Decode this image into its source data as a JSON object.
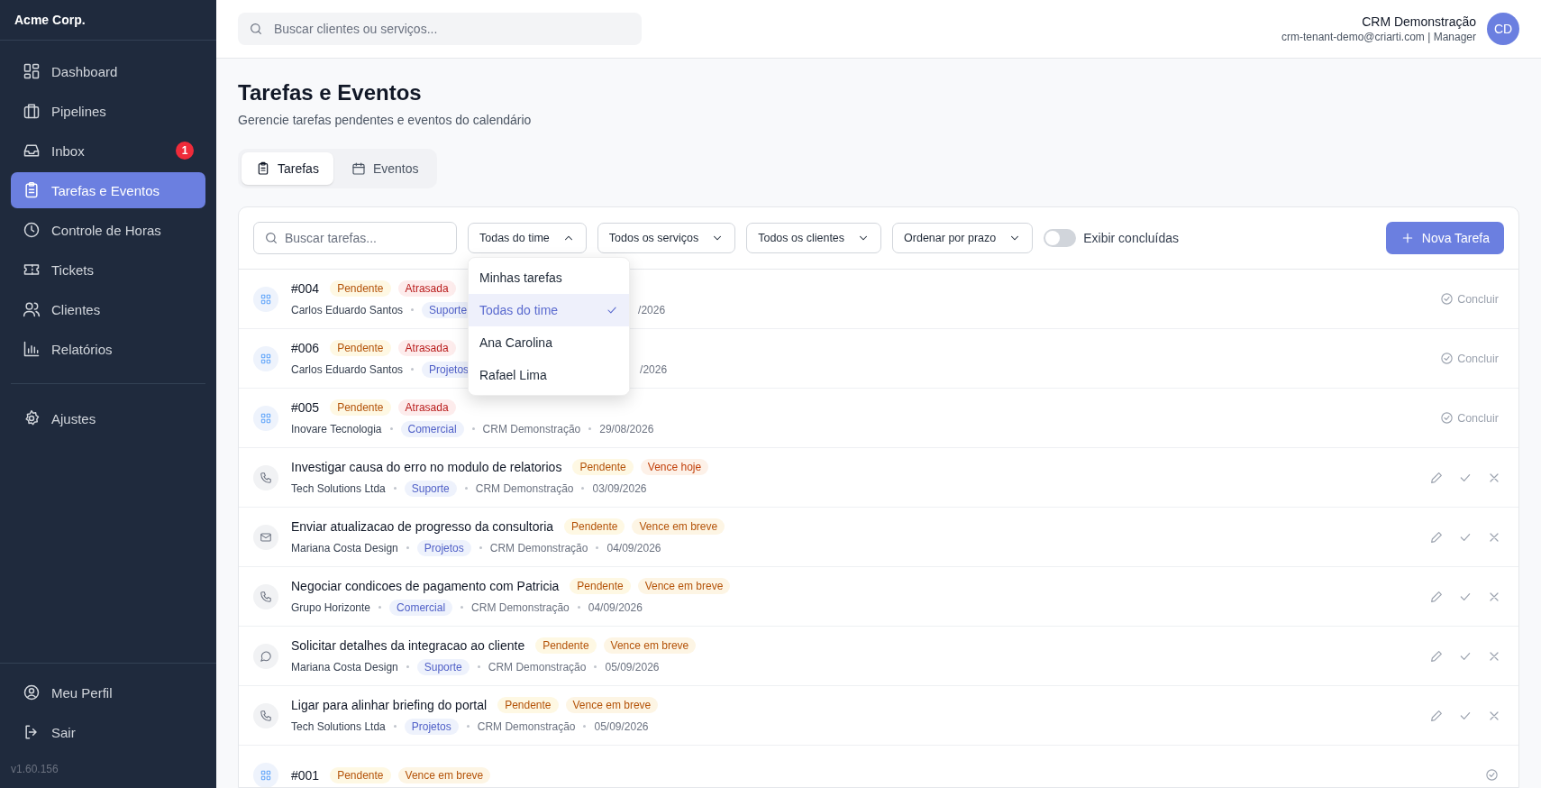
{
  "sidebar": {
    "brand": "Acme Corp.",
    "items": [
      {
        "label": "Dashboard",
        "selected": false
      },
      {
        "label": "Pipelines",
        "selected": false
      },
      {
        "label": "Inbox",
        "selected": false,
        "badge": "1"
      },
      {
        "label": "Tarefas e Eventos",
        "selected": true
      },
      {
        "label": "Controle de Horas",
        "selected": false
      },
      {
        "label": "Tickets",
        "selected": false
      },
      {
        "label": "Clientes",
        "selected": false
      },
      {
        "label": "Relatórios",
        "selected": false
      }
    ],
    "settings": {
      "label": "Ajustes",
      "selected": false
    },
    "footer_items": [
      {
        "label": "Meu Perfil"
      },
      {
        "label": "Sair"
      }
    ],
    "version": "v1.60.156"
  },
  "header": {
    "search": {
      "placeholder": "Buscar clientes ou serviços..."
    },
    "user": {
      "name": "CRM Demonstração",
      "details": "crm-tenant-demo@criarti.com | Manager",
      "initials": "CD"
    }
  },
  "page": {
    "title": "Tarefas e Eventos",
    "subtitle": "Gerencie tarefas pendentes e eventos do calendário"
  },
  "tabs": [
    {
      "label": "Tarefas",
      "selected": true
    },
    {
      "label": "Eventos",
      "selected": false
    }
  ],
  "filters": {
    "search": {
      "placeholder": "Buscar tarefas..."
    },
    "dropdowns": [
      {
        "label": "Todas do time",
        "expanded": true
      },
      {
        "label": "Todos os serviços",
        "expanded": false
      },
      {
        "label": "Todos os clientes",
        "expanded": false
      },
      {
        "label": "Ordenar por prazo",
        "expanded": false
      }
    ],
    "toggle": {
      "label": "Exibir concluídas",
      "on": false
    },
    "new_button": "Nova Tarefa"
  },
  "dropdown_menu": {
    "options": [
      {
        "label": "Minhas tarefas",
        "selected": false
      },
      {
        "label": "Todas do time",
        "selected": true
      },
      {
        "label": "Ana Carolina",
        "selected": false
      },
      {
        "label": "Rafael Lima",
        "selected": false
      }
    ]
  },
  "tasks": [
    {
      "kind": "code",
      "title": "#004",
      "badges": [
        {
          "label": "Pendente",
          "kind": "pending"
        },
        {
          "label": "Atrasada",
          "kind": "overdue"
        }
      ],
      "client": "Carlos Eduardo Santos",
      "service": "Suporte",
      "date": "/2026",
      "action": "Concluir"
    },
    {
      "kind": "code",
      "title": "#006",
      "badges": [
        {
          "label": "Pendente",
          "kind": "pending"
        },
        {
          "label": "Atrasada",
          "kind": "overdue"
        }
      ],
      "client": "Carlos Eduardo Santos",
      "service": "Projetos",
      "date": "/2026",
      "action": "Concluir"
    },
    {
      "kind": "code",
      "title": "#005",
      "badges": [
        {
          "label": "Pendente",
          "kind": "pending"
        },
        {
          "label": "Atrasada",
          "kind": "overdue"
        }
      ],
      "client": "Inovare Tecnologia",
      "service": "Comercial",
      "company": "CRM Demonstração",
      "date": "29/08/2026",
      "action": "Concluir"
    },
    {
      "kind": "call",
      "title": "Investigar causa do erro no modulo de relatorios",
      "badges": [
        {
          "label": "Pendente",
          "kind": "pending"
        },
        {
          "label": "Vence hoje",
          "kind": "due-today"
        }
      ],
      "client": "Tech Solutions Ltda",
      "service": "Suporte",
      "company": "CRM Demonstração",
      "date": "03/09/2026"
    },
    {
      "kind": "email",
      "title": "Enviar atualizacao de progresso da consultoria",
      "badges": [
        {
          "label": "Pendente",
          "kind": "pending"
        },
        {
          "label": "Vence em breve",
          "kind": "due-soon"
        }
      ],
      "client": "Mariana Costa Design",
      "service": "Projetos",
      "company": "CRM Demonstração",
      "date": "04/09/2026"
    },
    {
      "kind": "call",
      "title": "Negociar condicoes de pagamento com Patricia",
      "badges": [
        {
          "label": "Pendente",
          "kind": "pending"
        },
        {
          "label": "Vence em breve",
          "kind": "due-soon"
        }
      ],
      "client": "Grupo Horizonte",
      "service": "Comercial",
      "company": "CRM Demonstração",
      "date": "04/09/2026"
    },
    {
      "kind": "message",
      "title": "Solicitar detalhes da integracao ao cliente",
      "badges": [
        {
          "label": "Pendente",
          "kind": "pending"
        },
        {
          "label": "Vence em breve",
          "kind": "due-soon"
        }
      ],
      "client": "Mariana Costa Design",
      "service": "Suporte",
      "company": "CRM Demonstração",
      "date": "05/09/2026"
    },
    {
      "kind": "call",
      "title": "Ligar para alinhar briefing do portal",
      "badges": [
        {
          "label": "Pendente",
          "kind": "pending"
        },
        {
          "label": "Vence em breve",
          "kind": "due-soon"
        }
      ],
      "client": "Tech Solutions Ltda",
      "service": "Projetos",
      "company": "CRM Demonstração",
      "date": "05/09/2026"
    },
    {
      "kind": "code",
      "title": "#001",
      "badges": [
        {
          "label": "Pendente",
          "kind": "pending"
        },
        {
          "label": "Vence em breve",
          "kind": "due-soon"
        }
      ]
    }
  ]
}
